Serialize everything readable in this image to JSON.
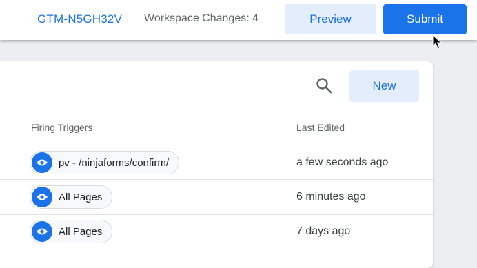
{
  "header": {
    "container_id": "GTM-N5GH32V",
    "workspace_changes": "Workspace Changes: 4",
    "preview_label": "Preview",
    "submit_label": "Submit"
  },
  "toolbar": {
    "search_icon": "search-icon",
    "new_label": "New"
  },
  "table": {
    "columns": [
      "Firing Triggers",
      "Last Edited"
    ],
    "rows": [
      {
        "trigger": "pv - /ninjaforms/confirm/",
        "last_edited": "a few seconds ago"
      },
      {
        "trigger": "All Pages",
        "last_edited": "6 minutes ago"
      },
      {
        "trigger": "All Pages",
        "last_edited": "7 days ago"
      }
    ]
  },
  "colors": {
    "accent": "#1a73e8",
    "accent_light": "#e3edfc",
    "background": "#eceef1"
  }
}
